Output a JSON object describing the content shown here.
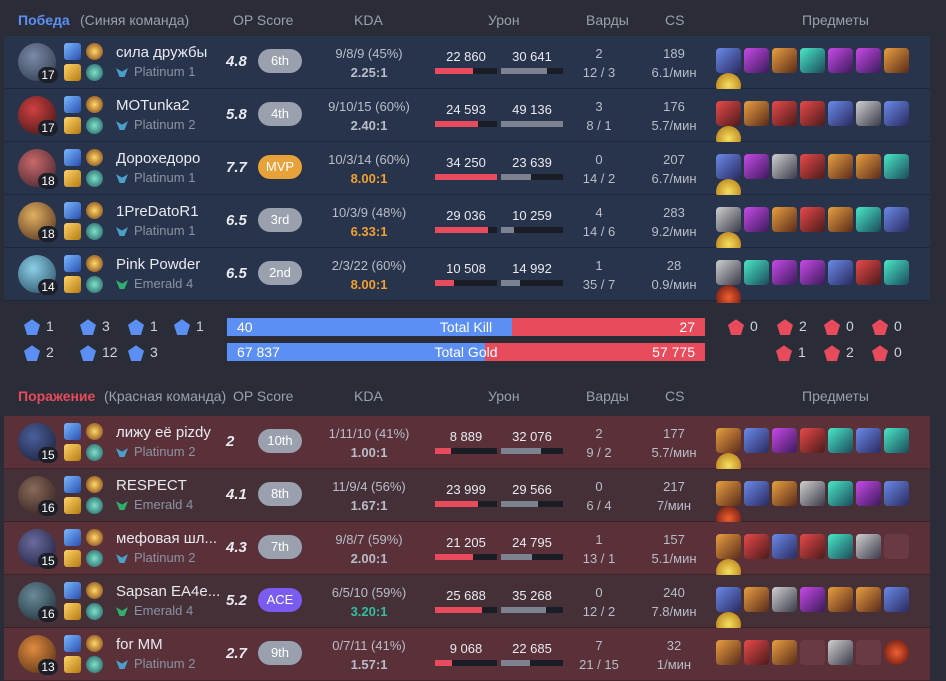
{
  "columns": {
    "op": "OP Score",
    "kda": "KDA",
    "damage": "Урон",
    "wards": "Варды",
    "cs": "CS",
    "items": "Предметы"
  },
  "blue": {
    "result": "Победа",
    "team": "(Синяя команда)",
    "players": [
      {
        "level": "17",
        "name": "сила дружбы",
        "rank": "Platinum 1",
        "tier": "pl",
        "op": "4.8",
        "badge": "6th",
        "kda_line": "9/8/9 (45%)",
        "kda_ratio": "2.25:1",
        "dmg_dealt": "22 860",
        "dmg_taken": "30 641",
        "dmg_dealt_pct": 0.62,
        "dmg_taken_pct": 0.74,
        "wards_placed": "2",
        "wards_detail": "12 / 3",
        "cs": "189",
        "cs_per_min": "6.1/мин",
        "items": [
          "i1",
          "i2",
          "i3",
          "i4",
          "i2",
          "i2",
          "i3",
          "i7"
        ]
      },
      {
        "level": "17",
        "name": "MOTunka2",
        "rank": "Platinum 2",
        "tier": "pl",
        "op": "5.8",
        "badge": "4th",
        "kda_line": "9/10/15 (60%)",
        "kda_ratio": "2.40:1",
        "dmg_dealt": "24 593",
        "dmg_taken": "49 136",
        "dmg_dealt_pct": 0.7,
        "dmg_taken_pct": 1.0,
        "wards_placed": "3",
        "wards_detail": "8 / 1",
        "cs": "176",
        "cs_per_min": "5.7/мин",
        "items": [
          "i5",
          "i3",
          "i5",
          "i5",
          "i1",
          "i6",
          "i1",
          "i7"
        ]
      },
      {
        "level": "18",
        "name": "Дорохедоро",
        "rank": "Platinum 1",
        "tier": "pl",
        "op": "7.7",
        "badge": "MVP",
        "badge_type": "mvp",
        "kda_line": "10/3/14 (60%)",
        "kda_ratio": "8.00:1",
        "ratio_color": "or",
        "dmg_dealt": "34 250",
        "dmg_taken": "23 639",
        "dmg_dealt_pct": 1.0,
        "dmg_taken_pct": 0.48,
        "wards_placed": "0",
        "wards_detail": "14 / 2",
        "cs": "207",
        "cs_per_min": "6.7/мин",
        "items": [
          "i1",
          "i2",
          "i6",
          "i5",
          "i3",
          "i3",
          "i4",
          "i7"
        ]
      },
      {
        "level": "18",
        "name": "1PreDatoR1",
        "rank": "Platinum 1",
        "tier": "pl",
        "op": "6.5",
        "badge": "3rd",
        "kda_line": "10/3/9 (48%)",
        "kda_ratio": "6.33:1",
        "ratio_color": "or",
        "dmg_dealt": "29 036",
        "dmg_taken": "10 259",
        "dmg_dealt_pct": 0.85,
        "dmg_taken_pct": 0.21,
        "wards_placed": "4",
        "wards_detail": "14 / 6",
        "cs": "283",
        "cs_per_min": "9.2/мин",
        "items": [
          "i6",
          "i2",
          "i3",
          "i5",
          "i3",
          "i4",
          "i1",
          "i7"
        ]
      },
      {
        "level": "14",
        "name": "Pink Powder",
        "rank": "Emerald 4",
        "tier": "em",
        "op": "6.5",
        "badge": "2nd",
        "kda_line": "2/3/22 (60%)",
        "kda_ratio": "8.00:1",
        "ratio_color": "or",
        "dmg_dealt": "10 508",
        "dmg_taken": "14 992",
        "dmg_dealt_pct": 0.31,
        "dmg_taken_pct": 0.31,
        "wards_placed": "1",
        "wards_detail": "35 / 7",
        "cs": "28",
        "cs_per_min": "0.9/мин",
        "items": [
          "i6",
          "i4",
          "i2",
          "i2",
          "i1",
          "i5",
          "i4",
          "i8"
        ]
      }
    ]
  },
  "summary": {
    "blue_obj": [
      "1",
      "3",
      "1",
      "1",
      "2",
      "12",
      "3"
    ],
    "red_obj": [
      "0",
      "2",
      "0",
      "0",
      "1",
      "2",
      "0"
    ],
    "kill_label": "Total Kill",
    "kill_blue": "40",
    "kill_red": "27",
    "kill_blue_share": 0.597,
    "gold_label": "Total Gold",
    "gold_blue": "67 837",
    "gold_red": "57 775",
    "gold_blue_share": 0.54
  },
  "red": {
    "result": "Поражение",
    "team": "(Красная команда)",
    "players": [
      {
        "level": "15",
        "name": "лижу её pizdy",
        "rank": "Platinum 2",
        "tier": "pl",
        "op": "2",
        "badge": "10th",
        "kda_line": "1/11/10 (41%)",
        "kda_ratio": "1.00:1",
        "dmg_dealt": "8 889",
        "dmg_taken": "32 076",
        "dmg_dealt_pct": 0.26,
        "dmg_taken_pct": 0.65,
        "wards_placed": "2",
        "wards_detail": "9 / 2",
        "cs": "177",
        "cs_per_min": "5.7/мин",
        "items": [
          "i3",
          "i1",
          "i2",
          "i5",
          "i4",
          "i1",
          "i4",
          "i7"
        ]
      },
      {
        "level": "16",
        "name": "RESPECT",
        "rank": "Emerald 4",
        "tier": "em",
        "op": "4.1",
        "badge": "8th",
        "kda_line": "11/9/4 (56%)",
        "kda_ratio": "1.67:1",
        "dmg_dealt": "23 999",
        "dmg_taken": "29 566",
        "dmg_dealt_pct": 0.7,
        "dmg_taken_pct": 0.6,
        "wards_placed": "0",
        "wards_detail": "6 / 4",
        "cs": "217",
        "cs_per_min": "7/мин",
        "items": [
          "i3",
          "i1",
          "i3",
          "i6",
          "i4",
          "i2",
          "i1",
          "i8"
        ]
      },
      {
        "level": "15",
        "name": "мефовая шл...",
        "rank": "Platinum 2",
        "tier": "pl",
        "op": "4.3",
        "badge": "7th",
        "kda_line": "9/8/7 (59%)",
        "kda_ratio": "2.00:1",
        "dmg_dealt": "21 205",
        "dmg_taken": "24 795",
        "dmg_dealt_pct": 0.62,
        "dmg_taken_pct": 0.5,
        "wards_placed": "1",
        "wards_detail": "13 / 1",
        "cs": "157",
        "cs_per_min": "5.1/мин",
        "items": [
          "i3",
          "i5",
          "i1",
          "i5",
          "i4",
          "i6",
          "empty",
          "i7"
        ]
      },
      {
        "level": "16",
        "name": "Sapsan EA4e...",
        "rank": "Emerald 4",
        "tier": "em",
        "op": "5.2",
        "badge": "ACE",
        "badge_type": "ace",
        "kda_line": "6/5/10 (59%)",
        "kda_ratio": "3.20:1",
        "ratio_color": "tl",
        "dmg_dealt": "25 688",
        "dmg_taken": "35 268",
        "dmg_dealt_pct": 0.75,
        "dmg_taken_pct": 0.72,
        "wards_placed": "0",
        "wards_detail": "12 / 2",
        "cs": "240",
        "cs_per_min": "7.8/мин",
        "items": [
          "i1",
          "i3",
          "i6",
          "i2",
          "i3",
          "i3",
          "i1",
          "i7"
        ]
      },
      {
        "level": "13",
        "name": "for MM",
        "rank": "Platinum 2",
        "tier": "pl",
        "op": "2.7",
        "badge": "9th",
        "kda_line": "0/7/11 (41%)",
        "kda_ratio": "1.57:1",
        "dmg_dealt": "9 068",
        "dmg_taken": "22 685",
        "dmg_dealt_pct": 0.27,
        "dmg_taken_pct": 0.46,
        "wards_placed": "7",
        "wards_detail": "21 / 15",
        "cs": "32",
        "cs_per_min": "1/мин",
        "items": [
          "i3",
          "i5",
          "i3",
          "empty",
          "i6",
          "empty",
          "i8"
        ]
      }
    ]
  }
}
